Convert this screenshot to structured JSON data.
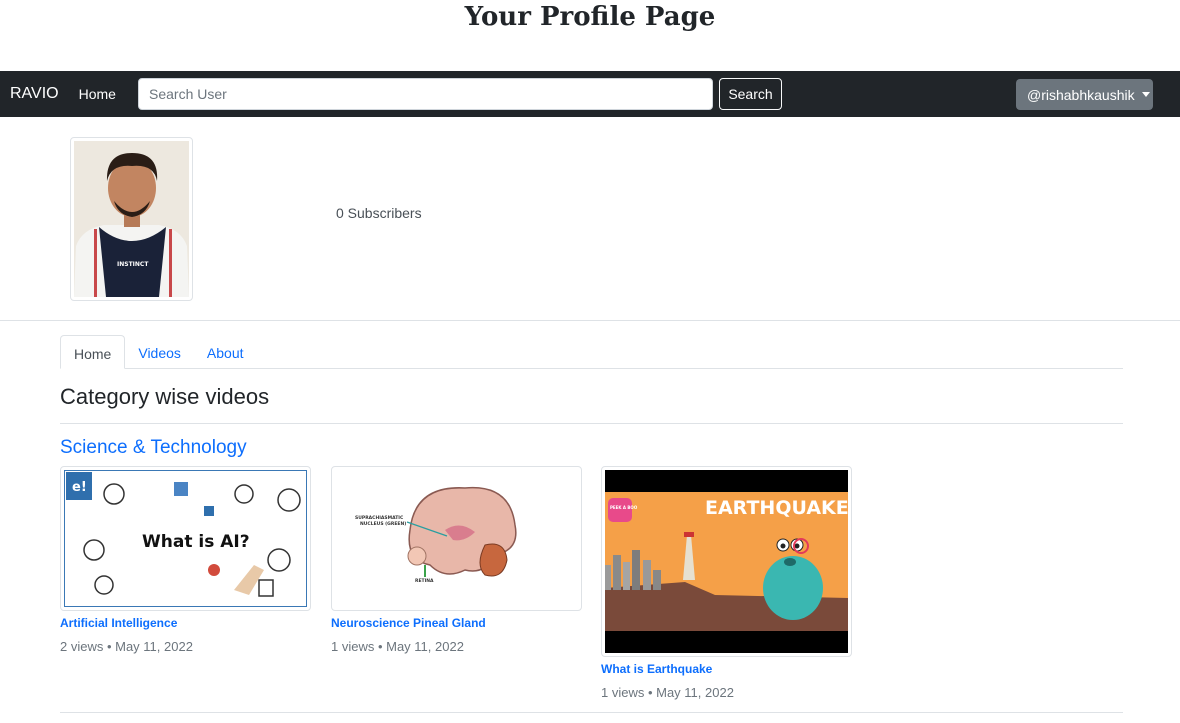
{
  "page": {
    "title": "Your Profile Page"
  },
  "navbar": {
    "brand": "RAVIO",
    "home": "Home",
    "search_placeholder": "Search User",
    "search_button": "Search",
    "user": "@rishabhkaushik"
  },
  "profile": {
    "subscribers": "0 Subscribers",
    "avatar_text": "INSTINCT"
  },
  "tabs": [
    {
      "label": "Home",
      "active": true
    },
    {
      "label": "Videos",
      "active": false
    },
    {
      "label": "About",
      "active": false
    }
  ],
  "section": {
    "heading": "Category wise videos"
  },
  "category": {
    "title": "Science & Technology",
    "videos": [
      {
        "title": "Artificial Intelligence",
        "meta": "2 views • May 11, 2022",
        "thumb_text": "What is AI?",
        "badge": "e!"
      },
      {
        "title": "Neuroscience Pineal Gland",
        "meta": "1 views • May 11, 2022",
        "thumb_label_1": "SUPRACHIASMATIC",
        "thumb_label_2": "NUCLEUS (GREEN)",
        "thumb_label_3": "RETINA"
      },
      {
        "title": "What is Earthquake",
        "meta": "1 views • May 11, 2022",
        "thumb_text": "EARTHQUAKE",
        "badge": "PEEK A BOO"
      }
    ]
  },
  "colors": {
    "navbar": "#212529",
    "link": "#0d6efd",
    "user_button": "#6c757d"
  }
}
